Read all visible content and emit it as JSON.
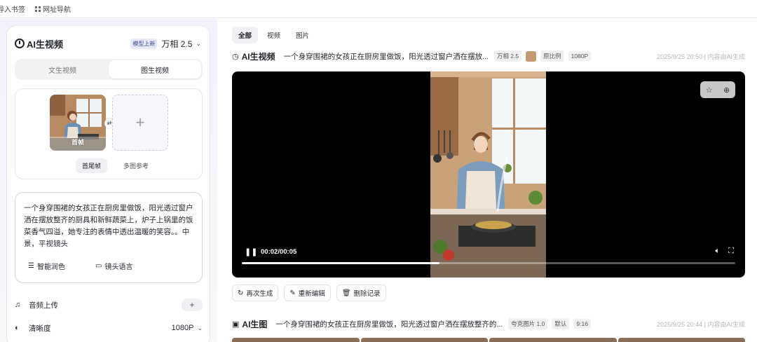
{
  "bookmarks": [
    {
      "label": "导入书签"
    },
    {
      "label": "网址导航"
    }
  ],
  "sidebar": {
    "title": "AI生视频",
    "model_badge": "模型上新",
    "model_name": "万相 2.5",
    "mode_tabs": [
      {
        "label": "文生视频"
      },
      {
        "label": "图生视频"
      }
    ],
    "frame_thumb_label": "首帧",
    "sub_tabs": [
      {
        "label": "首尾帧"
      },
      {
        "label": "多图参考"
      }
    ],
    "prompt": "一个身穿围裙的女孩正在厨房里做饭，阳光透过窗户洒在摆放整齐的厨具和新鲜蔬菜上，炉子上锅里的饭菜香气四溢，她专注的表情中透出温暖的笑容。。中景，平视镜头",
    "tools": [
      {
        "label": "智能润色"
      },
      {
        "label": "镜头语言"
      }
    ],
    "audio_upload_label": "音频上传",
    "resolution_label": "清晰度",
    "resolution_value": "1080P"
  },
  "filters": [
    {
      "label": "全部"
    },
    {
      "label": "视频"
    },
    {
      "label": "图片"
    }
  ],
  "results": [
    {
      "title": "AI生视频",
      "prompt": "一个身穿围裙的女孩正在厨房里做饭，阳光透过窗户洒在摆放...",
      "tags": [
        "万相 2.5",
        "原比例",
        "1080P"
      ],
      "meta": "2025/9/25 20:50 | 内容由AI生成"
    },
    {
      "title": "AI生图",
      "prompt": "一个身穿围裙的女孩正在厨房里做饭，阳光透过窗户洒在摆放整齐的...",
      "tags": [
        "夸克图片 1.0",
        "默认",
        "9:16"
      ],
      "meta": "2025/9/25 20:44 | 内容由AI生成"
    }
  ],
  "player": {
    "time": "00:02/00:05",
    "progress": 0.4
  },
  "result_actions": [
    {
      "label": "再次生成"
    },
    {
      "label": "重新编辑"
    },
    {
      "label": "删除记录"
    }
  ]
}
